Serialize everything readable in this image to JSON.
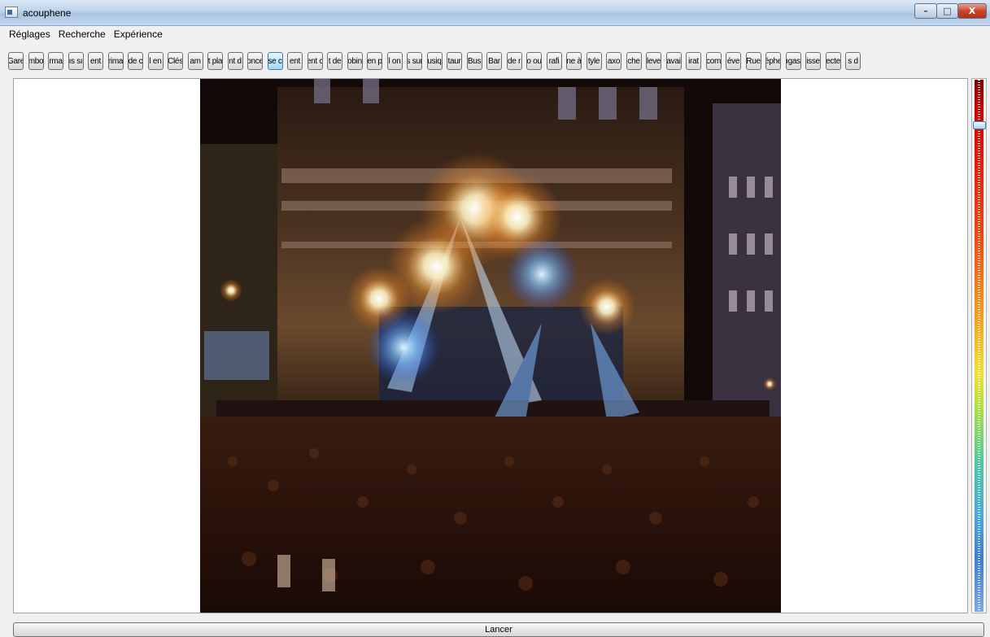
{
  "window": {
    "title": "acouphene",
    "minimize_label": "–",
    "maximize_label": "□",
    "close_label": "X"
  },
  "menu": {
    "items": [
      "Réglages",
      "Recherche",
      "Expérience"
    ]
  },
  "tags": {
    "selected_index": 13,
    "items": [
      "Gare",
      "mbo",
      "rma",
      "ıs sı",
      "ent",
      "rima",
      "de c",
      "l en",
      "Clés",
      "am",
      "t pla",
      "nt d",
      "once",
      "se c",
      "ent",
      "ent c",
      "t de",
      "obin",
      "en p",
      "l on",
      "s sur",
      "usiq",
      "taur",
      "Bus",
      "Bar",
      "de r",
      "o ou",
      "rafi",
      "ne à",
      "tyle",
      "axo",
      "che",
      "leve",
      "avai",
      "irat",
      "com",
      "éve",
      "Rue",
      "éphe",
      "ıgas",
      "isse",
      "ecte",
      "s d"
    ]
  },
  "main": {
    "photo_alt": "concert-stage-photo"
  },
  "slider": {
    "value_fraction": 0.08
  },
  "bottom": {
    "lancer_label": "Lancer"
  }
}
